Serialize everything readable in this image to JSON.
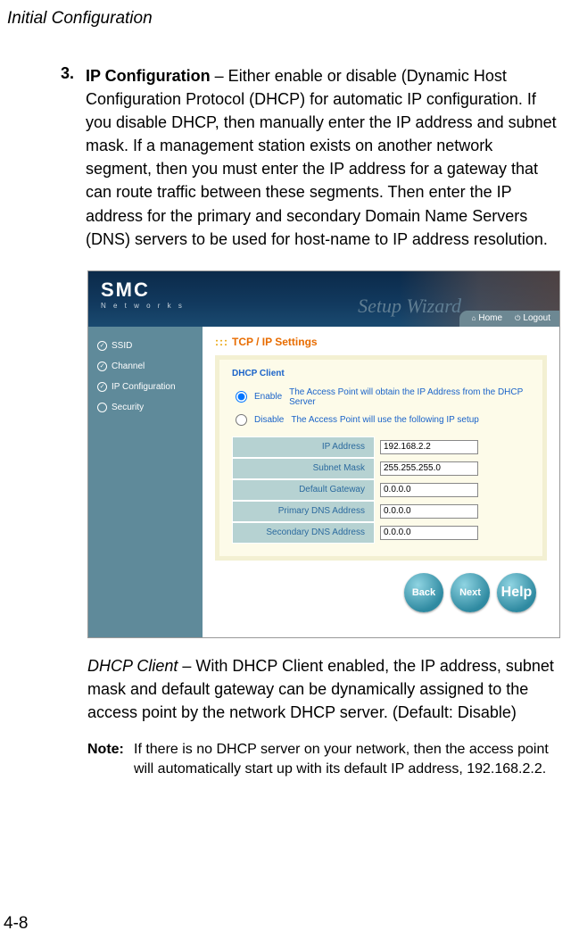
{
  "page": {
    "header": "Initial Configuration",
    "page_number": "4-8"
  },
  "step": {
    "number": "3.",
    "title": "IP Configuration",
    "body": " – Either enable or disable (Dynamic Host Configuration Protocol (DHCP) for automatic IP configuration. If you disable DHCP, then manually enter the IP address and subnet mask. If a management station exists on another network segment, then you must enter the IP address for a gateway that can route traffic between these segments. Then enter the IP address for the primary and secondary Domain Name Servers (DNS) servers to be used for host-name to IP address resolution."
  },
  "figure": {
    "logo_main": "SMC",
    "logo_sub": "N e t w o r k s",
    "wizard_text": "Setup Wizard",
    "nav": {
      "home": "Home",
      "logout": "Logout"
    },
    "sidebar": [
      {
        "label": "SSID",
        "done": true
      },
      {
        "label": "Channel",
        "done": true
      },
      {
        "label": "IP Configuration",
        "done": true
      },
      {
        "label": "Security",
        "done": false
      }
    ],
    "section_title": "TCP / IP Settings",
    "form_heading": "DHCP Client",
    "radios": {
      "enable": {
        "label": "Enable",
        "desc": "The Access Point  will obtain the IP Address from the DHCP Server"
      },
      "disable": {
        "label": "Disable",
        "desc": "The Access Point will use the following IP setup"
      }
    },
    "fields": [
      {
        "label": "IP Address",
        "value": "192.168.2.2"
      },
      {
        "label": "Subnet Mask",
        "value": "255.255.255.0"
      },
      {
        "label": "Default Gateway",
        "value": "0.0.0.0"
      },
      {
        "label": "Primary DNS Address",
        "value": "0.0.0.0"
      },
      {
        "label": "Secondary DNS Address",
        "value": "0.0.0.0"
      }
    ],
    "buttons": {
      "back": "Back",
      "next": "Next",
      "help": "Help"
    }
  },
  "dhcp_paragraph": {
    "lead": "DHCP Client",
    "body": " – With DHCP Client enabled, the IP address, subnet mask and default gateway can be dynamically assigned to the access point by the network DHCP server. (Default: Disable)"
  },
  "note": {
    "label": "Note:",
    "body": "If there is no DHCP server on your network, then the access point will automatically start up with its default IP address, 192.168.2.2."
  }
}
